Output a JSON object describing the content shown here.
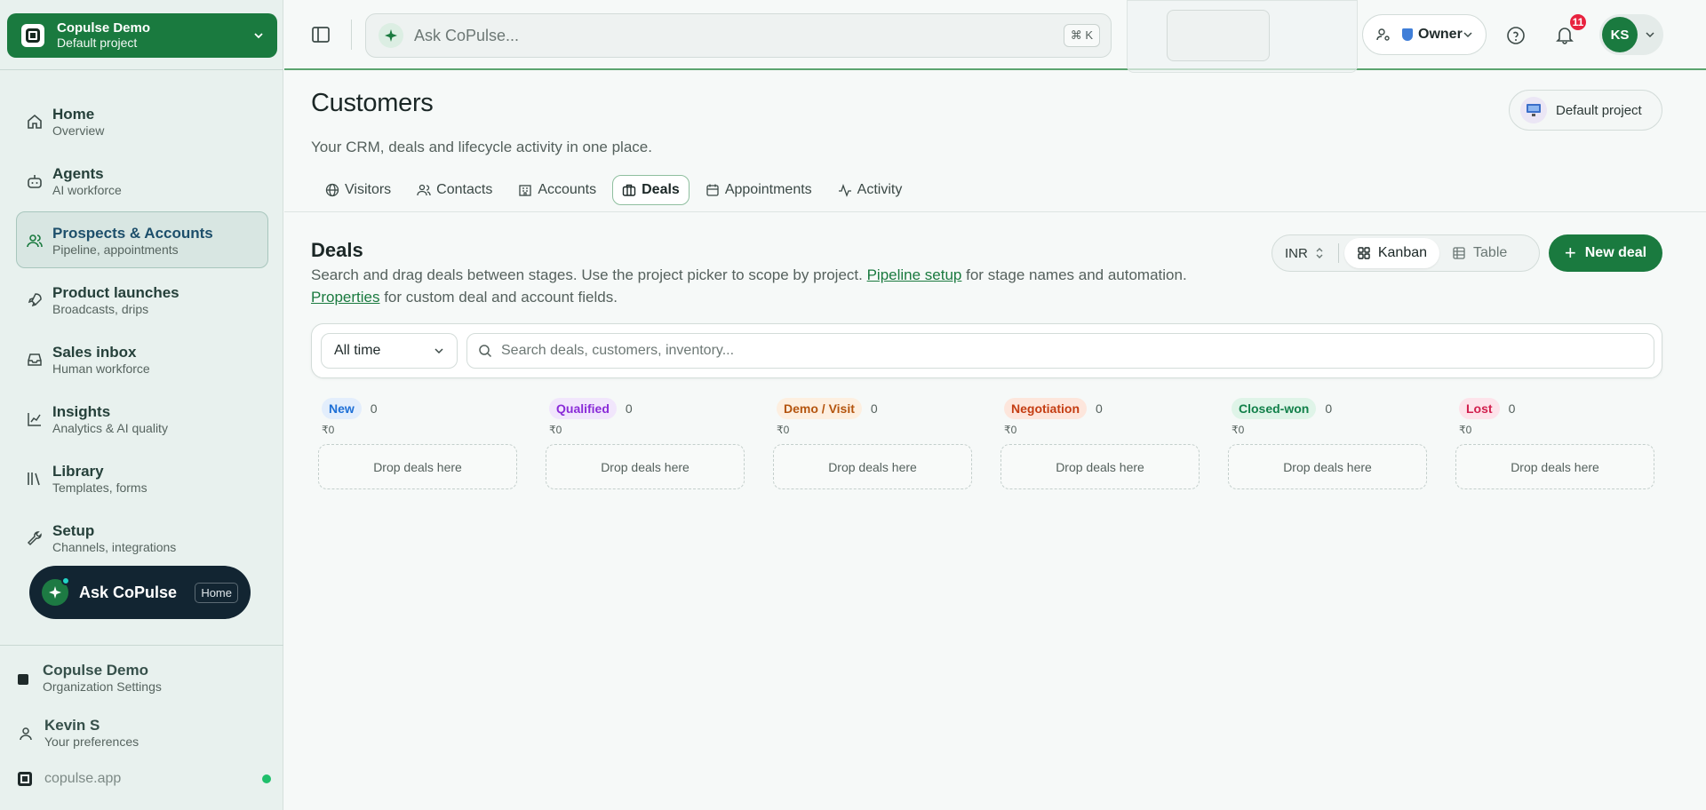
{
  "org": {
    "name": "Copulse Demo",
    "project": "Default project"
  },
  "sidebar": {
    "items": [
      {
        "title": "Home",
        "sub": "Overview"
      },
      {
        "title": "Agents",
        "sub": "AI workforce"
      },
      {
        "title": "Prospects & Accounts",
        "sub": "Pipeline, appointments"
      },
      {
        "title": "Product launches",
        "sub": "Broadcasts, drips"
      },
      {
        "title": "Sales inbox",
        "sub": "Human workforce"
      },
      {
        "title": "Insights",
        "sub": "Analytics & AI quality"
      },
      {
        "title": "Library",
        "sub": "Templates, forms"
      },
      {
        "title": "Setup",
        "sub": "Channels, integrations"
      }
    ],
    "ask": {
      "label": "Ask CoPulse",
      "badge": "Home"
    },
    "footer": {
      "org_title": "Copulse Demo",
      "org_sub": "Organization Settings",
      "user_title": "Kevin S",
      "user_sub": "Your preferences",
      "domain": "copulse.app"
    }
  },
  "topbar": {
    "search_placeholder": "Ask CoPulse...",
    "shortcut": "⌘ K",
    "role": "Owner",
    "notifications": "11",
    "user_initials": "KS"
  },
  "page": {
    "title": "Customers",
    "subtitle": "Your CRM, deals and lifecycle activity in one place.",
    "project_chip": "Default project",
    "tabs": [
      "Visitors",
      "Contacts",
      "Accounts",
      "Deals",
      "Appointments",
      "Activity"
    ]
  },
  "deals": {
    "title": "Deals",
    "desc_1": "Search and drag deals between stages. Use the project picker to scope by project. ",
    "link_pipeline": "Pipeline setup",
    "desc_2": " for stage names and automation.",
    "link_properties": "Properties",
    "desc_3": " for custom deal and account fields.",
    "currency": "INR",
    "view_kanban": "Kanban",
    "view_table": "Table",
    "new_deal": "New deal",
    "time_filter": "All time",
    "search_placeholder": "Search deals, customers, inventory...",
    "drop_label": "Drop deals here",
    "stages": [
      {
        "name": "New",
        "count": "0",
        "total": "₹0",
        "color": "#1d6fd6",
        "bg": "#e3eefc"
      },
      {
        "name": "Qualified",
        "count": "0",
        "total": "₹0",
        "color": "#8a2bd8",
        "bg": "#f1e6fc"
      },
      {
        "name": "Demo / Visit",
        "count": "0",
        "total": "₹0",
        "color": "#b4550f",
        "bg": "#fdefe0"
      },
      {
        "name": "Negotiation",
        "count": "0",
        "total": "₹0",
        "color": "#c43d12",
        "bg": "#fde6dc"
      },
      {
        "name": "Closed-won",
        "count": "0",
        "total": "₹0",
        "color": "#12804a",
        "bg": "#dff4e8"
      },
      {
        "name": "Lost",
        "count": "0",
        "total": "₹0",
        "color": "#d11f4d",
        "bg": "#fde3ea"
      }
    ]
  }
}
